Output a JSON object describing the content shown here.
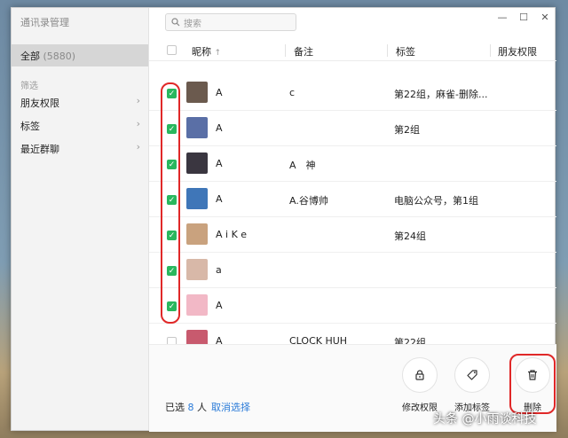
{
  "app_title": "通讯录管理",
  "sidebar": {
    "all_label": "全部",
    "all_count": "(5880)",
    "filter_label": "筛选",
    "items": [
      {
        "label": "朋友权限"
      },
      {
        "label": "标签"
      },
      {
        "label": "最近群聊"
      }
    ]
  },
  "search": {
    "placeholder": "搜索"
  },
  "columns": {
    "nickname": "昵称",
    "sort_arrow": "↑",
    "note": "备注",
    "tag": "标签",
    "permission": "朋友权限"
  },
  "rows": [
    {
      "nick": "A",
      "note": "c",
      "tag": "第22组，麻雀-删除...",
      "checked": true,
      "avatar_color": "#6b5a4e"
    },
    {
      "nick": "A",
      "note": "",
      "tag": "第2组",
      "checked": true,
      "avatar_color": "#5a6fa6"
    },
    {
      "nick": "A",
      "note": "A　神",
      "tag": "",
      "checked": true,
      "avatar_color": "#3a3640"
    },
    {
      "nick": "A",
      "note": "A.谷博帅",
      "tag": "电脑公众号，第1组",
      "checked": true,
      "avatar_color": "#3f76b8"
    },
    {
      "nick": "A i K e",
      "note": "",
      "tag": "第24组",
      "checked": true,
      "avatar_color": "#c9a27e"
    },
    {
      "nick": "a",
      "note": "",
      "tag": "",
      "checked": true,
      "avatar_color": "#d8b8a8"
    },
    {
      "nick": "A",
      "note": "",
      "tag": "",
      "checked": true,
      "avatar_color": "#f2b8c6"
    },
    {
      "nick": "A",
      "note": "CLOCK HUH",
      "tag": "第22组",
      "checked": false,
      "avatar_color": "#c85a6e"
    }
  ],
  "footer": {
    "selected_prefix": "已选",
    "selected_count": "8",
    "selected_suffix": "人",
    "cancel_label": "取消选择",
    "actions": [
      {
        "label": "修改权限",
        "icon": "lock-icon"
      },
      {
        "label": "添加标签",
        "icon": "tag-icon"
      },
      {
        "label": "删除",
        "icon": "trash-icon"
      }
    ]
  },
  "watermark": "头条 @小雨谈科技"
}
